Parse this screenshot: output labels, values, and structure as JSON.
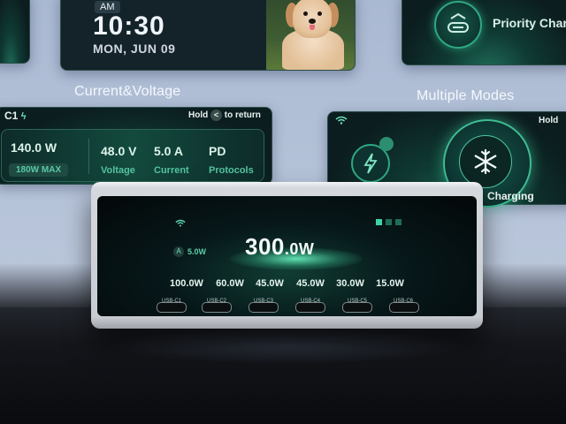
{
  "clock_panel": {
    "meridiem": "AM",
    "time": "10:30",
    "date": "MON, JUN 09"
  },
  "priority_panel": {
    "label": "Priority Char",
    "icon": "usb-c-icon"
  },
  "labels": {
    "current_voltage": "Current&Voltage",
    "multiple_modes": "Multiple Modes"
  },
  "current_panel": {
    "port_tag": "C1",
    "hold_prefix": "Hold",
    "hold_suffix": "to return",
    "power": "140.0 W",
    "max": "180W MAX",
    "voltage": "48.0 V",
    "voltage_label": "Voltage",
    "current": "5.0 A",
    "current_label": "Current",
    "protocol": "PD",
    "protocol_label": "Protocols"
  },
  "modes_panel": {
    "hold": "Hold",
    "mode_label": "Charging",
    "icon": "snowflake-icon"
  },
  "device": {
    "standby": "5.0W",
    "total_value": "300",
    "total_unit": ".0W",
    "ports": [
      {
        "watts": "100.0W",
        "label": "USB-C1"
      },
      {
        "watts": "60.0W",
        "label": "USB-C2"
      },
      {
        "watts": "45.0W",
        "label": "USB-C3"
      },
      {
        "watts": "45.0W",
        "label": "USB-C4"
      },
      {
        "watts": "30.0W",
        "label": "USB-C5"
      },
      {
        "watts": "15.0W",
        "label": "USB-C6"
      }
    ]
  },
  "colors": {
    "accent": "#3fd3a4",
    "screen": "#07181a",
    "background": "#b4c2d8"
  }
}
